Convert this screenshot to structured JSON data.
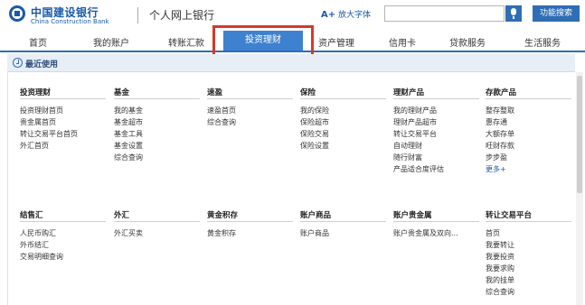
{
  "header": {
    "logo_cn": "中国建设银行",
    "logo_en": "China Construction Bank",
    "site_title": "个人网上银行",
    "font_btn_prefix": "A+",
    "font_btn_label": "放大字体",
    "search_placeholder": "",
    "search_button": "功能搜索"
  },
  "nav": {
    "items": [
      {
        "label": "首页"
      },
      {
        "label": "我的账户"
      },
      {
        "label": "转账汇款"
      },
      {
        "label": "投资理财",
        "active": true
      },
      {
        "label": "资产管理"
      },
      {
        "label": "信用卡"
      },
      {
        "label": "贷款服务"
      },
      {
        "label": "生活服务"
      }
    ]
  },
  "recent": {
    "label": "最近使用"
  },
  "sections": [
    {
      "title": "投资理财",
      "items": [
        "投资理财首页",
        "贵金属首页",
        "转让交易平台首页",
        "外汇首页"
      ]
    },
    {
      "title": "基金",
      "items": [
        "我的基金",
        "基金超市",
        "基金工具",
        "基金设置",
        "综合查询"
      ]
    },
    {
      "title": "速盈",
      "items": [
        "速盈首页",
        "综合查询"
      ]
    },
    {
      "title": "保险",
      "items": [
        "我的保险",
        "保险超市",
        "保险交易",
        "保险设置"
      ]
    },
    {
      "title": "理财产品",
      "items": [
        "我的理财产品",
        "理财产品超市",
        "转让交易平台",
        "自动理财",
        "随行财富",
        "产品适合度评估"
      ]
    },
    {
      "title": "存款产品",
      "items": [
        "整存整取",
        "惠存通",
        "大额存单",
        "旺财存款",
        "步步盈",
        "更多+"
      ]
    },
    {
      "title": "结售汇",
      "items": [
        "人民币购汇",
        "外币结汇",
        "交易明细查询"
      ]
    },
    {
      "title": "外汇",
      "items": [
        "外汇买卖"
      ]
    },
    {
      "title": "黄金积存",
      "items": [
        "黄金积存"
      ]
    },
    {
      "title": "账户商品",
      "items": [
        "账户商品"
      ]
    },
    {
      "title": "账户贵金属",
      "items": [
        "账户贵金属及双向..."
      ]
    },
    {
      "title": "转让交易平台",
      "items": [
        "首页",
        "我要转让",
        "我要投资",
        "我要求购",
        "我的挂单",
        "综合查询"
      ]
    }
  ]
}
